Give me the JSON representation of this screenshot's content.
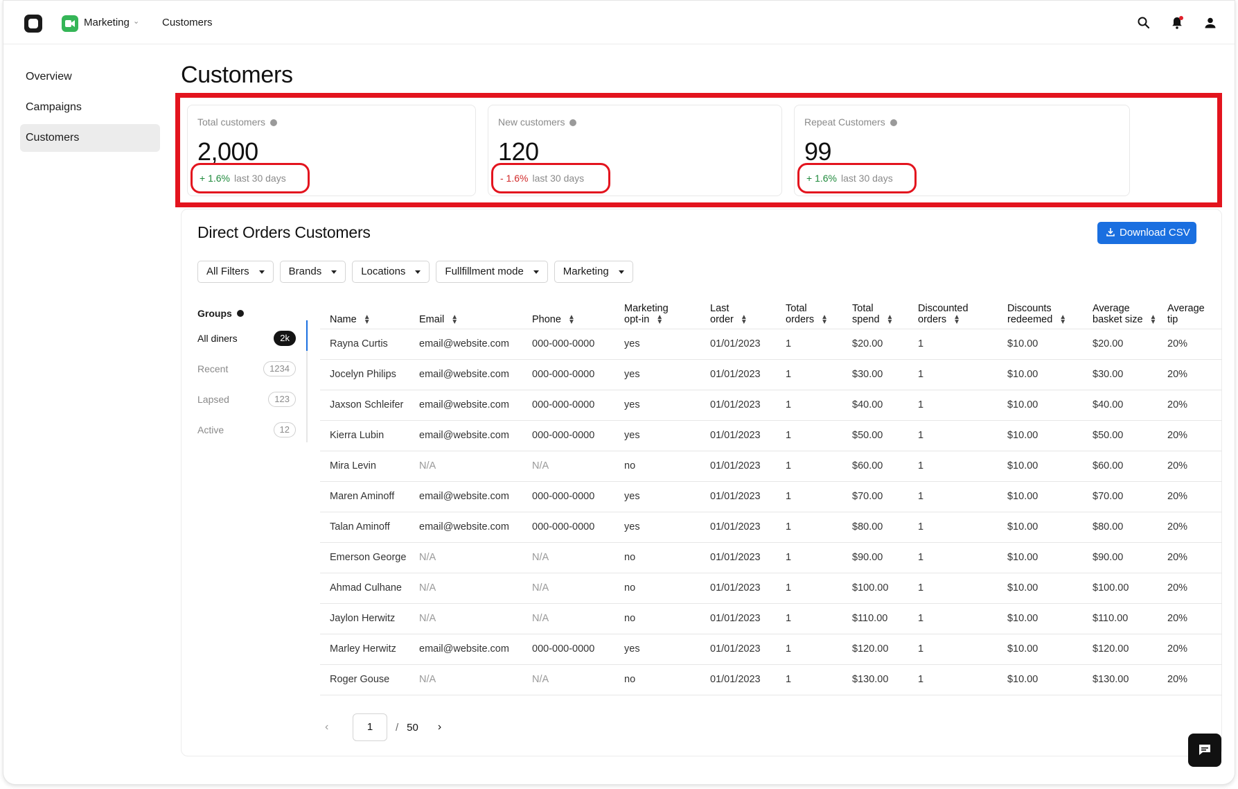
{
  "topbar": {
    "app_label": "Marketing",
    "breadcrumb": "Customers"
  },
  "sidebar": {
    "items": [
      {
        "label": "Overview"
      },
      {
        "label": "Campaigns"
      },
      {
        "label": "Customers",
        "active": true
      }
    ]
  },
  "page": {
    "title": "Customers"
  },
  "stats": [
    {
      "label": "Total customers",
      "value": "2,000",
      "trend": "+ 1.6%",
      "direction": "up",
      "period": "last 30 days"
    },
    {
      "label": "New customers",
      "value": "120",
      "trend": "- 1.6%",
      "direction": "down",
      "period": "last 30 days"
    },
    {
      "label": "Repeat Customers",
      "value": "99",
      "trend": "+ 1.6%",
      "direction": "up",
      "period": "last 30 days"
    }
  ],
  "panel": {
    "title": "Direct Orders Customers",
    "download_label": "Download CSV"
  },
  "filters": [
    "All Filters",
    "Brands",
    "Locations",
    "Fullfillment mode",
    "Marketing"
  ],
  "groups": {
    "heading": "Groups",
    "items": [
      {
        "label": "All diners",
        "count": "2k",
        "active": true
      },
      {
        "label": "Recent",
        "count": "1234"
      },
      {
        "label": "Lapsed",
        "count": "123"
      },
      {
        "label": "Active",
        "count": "12"
      }
    ]
  },
  "table": {
    "columns": [
      [
        "Name"
      ],
      [
        "Email"
      ],
      [
        "Phone"
      ],
      [
        "Marketing",
        "opt-in"
      ],
      [
        "Last",
        "order"
      ],
      [
        "Total",
        "orders"
      ],
      [
        "Total",
        "spend"
      ],
      [
        "Discounted",
        "orders"
      ],
      [
        "Discounts",
        "redeemed"
      ],
      [
        "Average",
        "basket size"
      ],
      [
        "Average",
        "tip"
      ]
    ],
    "rows": [
      [
        "Rayna Curtis",
        "email@website.com",
        "000-000-0000",
        "yes",
        "01/01/2023",
        "1",
        "$20.00",
        "1",
        "$10.00",
        "$20.00",
        "20%"
      ],
      [
        "Jocelyn Philips",
        "email@website.com",
        "000-000-0000",
        "yes",
        "01/01/2023",
        "1",
        "$30.00",
        "1",
        "$10.00",
        "$30.00",
        "20%"
      ],
      [
        "Jaxson Schleifer",
        "email@website.com",
        "000-000-0000",
        "yes",
        "01/01/2023",
        "1",
        "$40.00",
        "1",
        "$10.00",
        "$40.00",
        "20%"
      ],
      [
        "Kierra Lubin",
        "email@website.com",
        "000-000-0000",
        "yes",
        "01/01/2023",
        "1",
        "$50.00",
        "1",
        "$10.00",
        "$50.00",
        "20%"
      ],
      [
        "Mira Levin",
        "N/A",
        "N/A",
        "no",
        "01/01/2023",
        "1",
        "$60.00",
        "1",
        "$10.00",
        "$60.00",
        "20%"
      ],
      [
        "Maren Aminoff",
        "email@website.com",
        "000-000-0000",
        "yes",
        "01/01/2023",
        "1",
        "$70.00",
        "1",
        "$10.00",
        "$70.00",
        "20%"
      ],
      [
        "Talan Aminoff",
        "email@website.com",
        "000-000-0000",
        "yes",
        "01/01/2023",
        "1",
        "$80.00",
        "1",
        "$10.00",
        "$80.00",
        "20%"
      ],
      [
        "Emerson George",
        "N/A",
        "N/A",
        "no",
        "01/01/2023",
        "1",
        "$90.00",
        "1",
        "$10.00",
        "$90.00",
        "20%"
      ],
      [
        "Ahmad Culhane",
        "N/A",
        "N/A",
        "no",
        "01/01/2023",
        "1",
        "$100.00",
        "1",
        "$10.00",
        "$100.00",
        "20%"
      ],
      [
        "Jaylon Herwitz",
        "N/A",
        "N/A",
        "no",
        "01/01/2023",
        "1",
        "$110.00",
        "1",
        "$10.00",
        "$110.00",
        "20%"
      ],
      [
        "Marley Herwitz",
        "email@website.com",
        "000-000-0000",
        "yes",
        "01/01/2023",
        "1",
        "$120.00",
        "1",
        "$10.00",
        "$120.00",
        "20%"
      ],
      [
        "Roger Gouse",
        "N/A",
        "N/A",
        "no",
        "01/01/2023",
        "1",
        "$130.00",
        "1",
        "$10.00",
        "$130.00",
        "20%"
      ]
    ]
  },
  "pagination": {
    "current": "1",
    "separator": "/",
    "total": "50"
  },
  "colors": {
    "accent": "#1a6fe0",
    "highlight": "#e3141e",
    "positive": "#1f8a3c",
    "negative": "#d12a2a",
    "brand": "#35b557"
  }
}
